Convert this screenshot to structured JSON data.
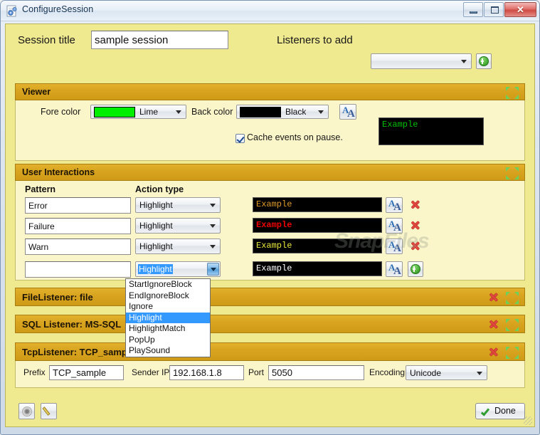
{
  "window": {
    "title": "ConfigureSession",
    "icon": "configure-session-icon",
    "minimize_label": "",
    "maximize_label": "",
    "close_label": "✕"
  },
  "top": {
    "session_title_label": "Session title",
    "session_title_value": "sample session",
    "listeners_label": "Listeners to add",
    "listeners_value": "",
    "add_listener_icon": "green-plus-icon"
  },
  "viewer": {
    "header": "Viewer",
    "fore_color_label": "Fore color",
    "fore_color_value": "Lime",
    "fore_color_hex": "#00ee00",
    "back_color_label": "Back color",
    "back_color_value": "Black",
    "back_color_hex": "#000000",
    "font_button_icon": "font-aa-icon",
    "cache_label": "Cache events on pause.",
    "cache_checked": true,
    "preview_text": "Example",
    "preview_fg": "#00c000",
    "preview_bg": "#000000"
  },
  "interactions": {
    "header": "User Interactions",
    "col_pattern": "Pattern",
    "col_action": "Action type",
    "rows": [
      {
        "pattern": "Error",
        "action": "Highlight",
        "preview_text": "Example",
        "preview_fg": "#e09a2a",
        "preview_bg": "#000000",
        "preview_bold": false,
        "font_icon": "font-aa-icon",
        "action_icon": "delete-x-icon"
      },
      {
        "pattern": "Failure",
        "action": "Highlight",
        "preview_text": "Example",
        "preview_fg": "#ee0000",
        "preview_bg": "#000000",
        "preview_bold": true,
        "font_icon": "font-aa-icon",
        "action_icon": "delete-x-icon"
      },
      {
        "pattern": "Warn",
        "action": "Highlight",
        "preview_text": "Example",
        "preview_fg": "#e8e83c",
        "preview_bg": "#000000",
        "preview_bold": false,
        "font_icon": "font-aa-icon",
        "action_icon": "delete-x-icon"
      },
      {
        "pattern": "",
        "action": "Highlight",
        "preview_text": "Example",
        "preview_fg": "#ffffff",
        "preview_bg": "#000000",
        "preview_bold": false,
        "font_icon": "font-aa-icon",
        "action_icon": "green-plus-icon"
      }
    ],
    "open_dropdown": {
      "selected": "Highlight",
      "options": [
        "StartIgnoreBlock",
        "EndIgnoreBlock",
        "Ignore",
        "Highlight",
        "HighlightMatch",
        "PopUp",
        "PlaySound"
      ]
    }
  },
  "listeners": [
    {
      "header": "FileListener: file",
      "delete_icon": "delete-x-icon",
      "expand_icon": "expand-arrows-icon"
    },
    {
      "header": "SQL Listener: MS-SQL",
      "delete_icon": "delete-x-icon",
      "expand_icon": "expand-arrows-icon"
    }
  ],
  "tcp": {
    "header": "TcpListener: TCP_sample",
    "prefix_label": "Prefix",
    "prefix_value": "TCP_sample",
    "sender_ip_label": "Sender IP",
    "sender_ip_value": "192.168.1.8",
    "port_label": "Port",
    "port_value": "5050",
    "encoding_label": "Encoding",
    "encoding_value": "Unicode",
    "delete_icon": "delete-x-icon",
    "expand_icon": "expand-arrows-icon"
  },
  "footer": {
    "settings_icon": "gear-icon",
    "edit_icon": "pencil-icon",
    "done_label": "Done",
    "done_icon": "green-check-icon"
  },
  "watermark": "SnapFiles",
  "colors": {
    "header_gold": "#d9a521",
    "panel_yellow": "#fbf6c9",
    "client_yellow": "#efe98f",
    "highlight_blue": "#3399ff"
  }
}
